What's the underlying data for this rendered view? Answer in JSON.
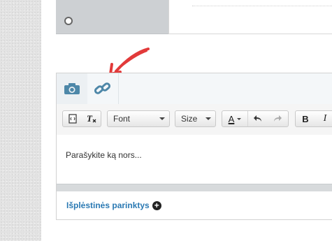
{
  "editor": {
    "placeholder_text": "Parašykite ką nors...",
    "tabs": [
      {
        "icon": "camera-icon"
      },
      {
        "icon": "link-icon"
      }
    ],
    "toolbar": {
      "font_label": "Font",
      "size_label": "Size",
      "text_color_label": "A",
      "bold_label": "B",
      "italic_label": "I"
    },
    "advanced_options_label": "Išplėstinės parinktys"
  },
  "colors": {
    "accent": "#2a79b3",
    "tab_icon": "#4d87a8",
    "arrow": "#e23a3a"
  }
}
